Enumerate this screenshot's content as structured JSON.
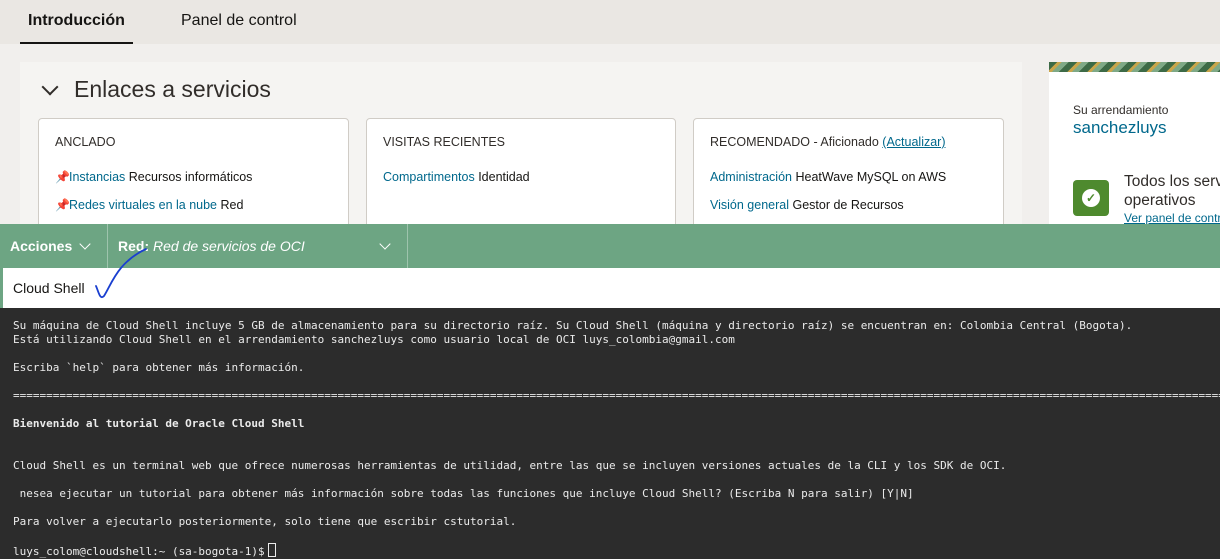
{
  "tabs": [
    {
      "label": "Introducción",
      "active": true
    },
    {
      "label": "Panel de control",
      "active": false
    }
  ],
  "links_section": {
    "title": "Enlaces a servicios",
    "cards": [
      {
        "header": "ANCLADO",
        "items": [
          {
            "link": "Instancias",
            "service": "Recursos informáticos",
            "icon": "pin-icon"
          },
          {
            "link": "Redes virtuales en la nube",
            "service": "Red",
            "icon": "pin-icon"
          }
        ]
      },
      {
        "header": "VISITAS RECIENTES",
        "items": [
          {
            "link": "Compartimentos",
            "service": "Identidad"
          }
        ]
      },
      {
        "header": "RECOMENDADO - Aficionado",
        "header_link": "(Actualizar)",
        "items": [
          {
            "link": "Administración",
            "service": "HeatWave MySQL on AWS"
          },
          {
            "link": "Visión general",
            "service": "Gestor de Recursos"
          }
        ]
      }
    ]
  },
  "tenancy": {
    "label": "Su arrendamiento",
    "name": "sanchezluys",
    "status_line1": "Todos los serv",
    "status_line2": "operativos",
    "status_link": "Ver panel de contr",
    "icon": "check-circle-icon"
  },
  "cloud_shell_toolbar": {
    "actions_label": "Acciones",
    "network_label": "Red:",
    "network_value": "Red de servicios de OCI"
  },
  "cloud_shell": {
    "title": "Cloud Shell",
    "lines": [
      {
        "text": "Su máquina de Cloud Shell incluye 5 GB de almacenamiento para su directorio raíz. Su Cloud Shell (máquina y directorio raíz) se encuentran en: Colombia Central (Bogota).",
        "bold": false
      },
      {
        "text": "Está utilizando Cloud Shell en el arrendamiento sanchezluys como usuario local de OCI luys_colombia@gmail.com",
        "bold": false
      },
      {
        "text": "Escriba `help` para obtener más información.",
        "bold": false
      },
      {
        "text": "==================================================================================================================================================================================================",
        "bold": false
      },
      {
        "text": "Bienvenido al tutorial de Oracle Cloud Shell",
        "bold": true
      },
      {
        "text": "Cloud Shell es un terminal web que ofrece numerosas herramientas de utilidad, entre las que se incluyen versiones actuales de la CLI y los SDK de OCI.",
        "bold": false
      },
      {
        "text": " nesea ejecutar un tutorial para obtener más información sobre todas las funciones que incluye Cloud Shell? (Escriba N para salir) [Y|N]",
        "bold": false
      },
      {
        "text": "Para volver a ejecutarlo posteriormente, solo tiene que escribir cstutorial.",
        "bold": false
      },
      {
        "text": "luys_colom@cloudshell:~ (sa-bogota-1)$",
        "bold": false
      }
    ]
  },
  "colors": {
    "toolbar_bg": "#6da583",
    "terminal_bg": "#2c2c2c",
    "link": "#00688c",
    "status_ok": "#4e8a2e",
    "annotation": "#1a3fd0"
  }
}
